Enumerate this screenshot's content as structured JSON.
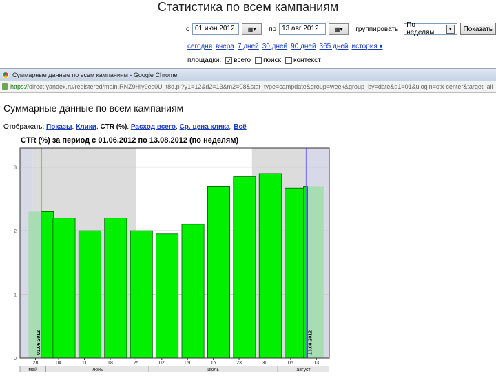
{
  "page": {
    "title": "Статистика по всем кампаниям",
    "filter": {
      "from_label": "с",
      "from_value": "01 июн 2012",
      "to_label": "по",
      "to_value": "13 авг 2012",
      "calendar_label": "▦▾",
      "group_label": "группировать",
      "group_value": "По неделям",
      "show_button": "Показать"
    },
    "period_links": [
      "сегодня",
      "вчера",
      "7 дней",
      "30 дней",
      "90 дней",
      "365 дней",
      "история ▾"
    ],
    "places": {
      "label": "площадки:",
      "options": [
        {
          "label": "всего",
          "checked": true
        },
        {
          "label": "поиск",
          "checked": false
        },
        {
          "label": "контекст",
          "checked": false
        }
      ]
    }
  },
  "chrome": {
    "window_title": "Суммарные данные по всем кампаниям - Google Chrome",
    "url_scheme": "https://",
    "url_rest": "direct.yandex.ru/registered/main.RNZ9Hiy9es0U_t8d.pl?y1=12&d2=13&m2=08&stat_type=campdate&group=week&group_by=date&d1=01&ulogin=ctk-center&target_all"
  },
  "content": {
    "title": "Суммарные данные по всем кампаниям",
    "display_label": "Отображать:",
    "display_links": [
      "Показы",
      "Клики",
      "CTR (%)",
      "Расход всего",
      "Ср. цена клика",
      "Всё"
    ],
    "display_current": "CTR (%)"
  },
  "chart_data": {
    "type": "bar",
    "title": "CTR (%) за период с 01.06.2012 по 13.08.2012 (по неделям)",
    "categories": [
      "28",
      "04",
      "11",
      "18",
      "25",
      "02",
      "09",
      "16",
      "23",
      "30",
      "06",
      "13"
    ],
    "months": [
      {
        "label": "май",
        "from": 0,
        "to": 1
      },
      {
        "label": "июнь",
        "from": 1,
        "to": 5
      },
      {
        "label": "июль",
        "from": 5,
        "to": 10
      },
      {
        "label": "август",
        "from": 10,
        "to": 12
      }
    ],
    "values": [
      2.3,
      2.2,
      2.0,
      2.2,
      2.0,
      1.95,
      2.1,
      2.7,
      2.85,
      2.9,
      2.67,
      2.7
    ],
    "partial_left": 2.3,
    "partial_right": 2.7,
    "ylim": [
      0,
      3.3
    ],
    "yticks": [
      0,
      1,
      2,
      3
    ],
    "period_start": "01.06.2012",
    "period_end": "13.08.2012",
    "colors": {
      "bar": "#00f000",
      "partial": "#a8ddb4",
      "band_grey": "#dcdcdc",
      "band_edge": "#d7d9e6",
      "marker": "#6a6af0"
    }
  }
}
